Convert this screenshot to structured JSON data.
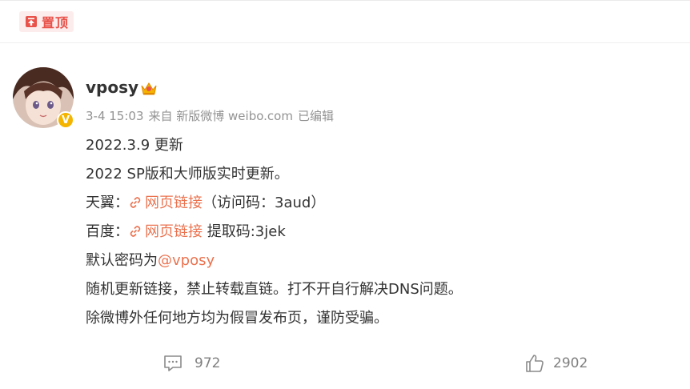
{
  "pin": {
    "label": "置顶",
    "color": "#e8524a"
  },
  "post": {
    "user": {
      "name": "vposy",
      "verified_badge": "V"
    },
    "meta": {
      "time": "3-4 15:03",
      "source": "来自 新版微博 weibo.com",
      "edited": "已编辑"
    },
    "lines": {
      "l1": "2022.3.9 更新",
      "l2": "2022 SP版和大师版实时更新。",
      "l3_prefix": "天翼：",
      "l3_link": "网页链接",
      "l3_suffix": "（访问码：3aud）",
      "l4_prefix": "百度：",
      "l4_link": "网页链接",
      "l4_suffix": " 提取码:3jek",
      "l5_prefix": "默认密码为",
      "l5_mention": "@vposy",
      "l6": "随机更新链接，禁止转载直链。打不开自行解决DNS问题。",
      "l7": "除微博外任何地方均为假冒发布页，谨防受骗。"
    },
    "link_color": "#eb7350"
  },
  "footer": {
    "comments": "972",
    "likes": "2902",
    "comment_icon": "comment-icon",
    "like_icon": "thumbs-up-icon"
  }
}
